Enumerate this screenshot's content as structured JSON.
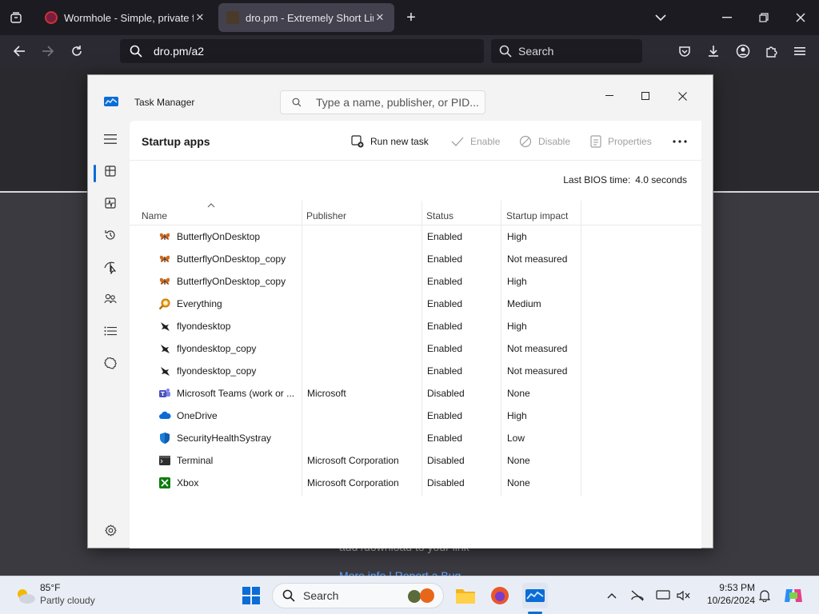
{
  "browser": {
    "tabs": [
      {
        "title": "Wormhole - Simple, private file",
        "active": false
      },
      {
        "title": "dro.pm - Extremely Short Links",
        "active": true
      }
    ],
    "url": "dro.pm/a2",
    "search_placeholder": "Search"
  },
  "background_page": {
    "text": "add /download to your link",
    "links": "More info | Report a Bug"
  },
  "task_manager": {
    "app_title": "Task Manager",
    "search_placeholder": "Type a name, publisher, or PID...",
    "section_title": "Startup apps",
    "toolbar": {
      "run_new_task": "Run new task",
      "enable": "Enable",
      "disable": "Disable",
      "properties": "Properties"
    },
    "bios_label": "Last BIOS time:",
    "bios_value": "4.0 seconds",
    "columns": {
      "name": "Name",
      "publisher": "Publisher",
      "status": "Status",
      "impact": "Startup impact"
    },
    "rows": [
      {
        "name": "ButterflyOnDesktop",
        "publisher": "",
        "status": "Enabled",
        "impact": "High",
        "icon": "butterfly-icon"
      },
      {
        "name": "ButterflyOnDesktop_copy",
        "publisher": "",
        "status": "Enabled",
        "impact": "Not measured",
        "icon": "butterfly-icon"
      },
      {
        "name": "ButterflyOnDesktop_copy",
        "publisher": "",
        "status": "Enabled",
        "impact": "High",
        "icon": "butterfly-icon"
      },
      {
        "name": "Everything",
        "publisher": "",
        "status": "Enabled",
        "impact": "Medium",
        "icon": "magnifier-icon"
      },
      {
        "name": "flyondesktop",
        "publisher": "",
        "status": "Enabled",
        "impact": "High",
        "icon": "bird-icon"
      },
      {
        "name": "flyondesktop_copy",
        "publisher": "",
        "status": "Enabled",
        "impact": "Not measured",
        "icon": "bird-icon"
      },
      {
        "name": "flyondesktop_copy",
        "publisher": "",
        "status": "Enabled",
        "impact": "Not measured",
        "icon": "bird-icon"
      },
      {
        "name": "Microsoft Teams (work or ...",
        "publisher": "Microsoft",
        "status": "Disabled",
        "impact": "None",
        "icon": "teams-icon"
      },
      {
        "name": "OneDrive",
        "publisher": "",
        "status": "Enabled",
        "impact": "High",
        "icon": "cloud-icon"
      },
      {
        "name": "SecurityHealthSystray",
        "publisher": "",
        "status": "Enabled",
        "impact": "Low",
        "icon": "shield-icon"
      },
      {
        "name": "Terminal",
        "publisher": "Microsoft Corporation",
        "status": "Disabled",
        "impact": "None",
        "icon": "terminal-icon"
      },
      {
        "name": "Xbox",
        "publisher": "Microsoft Corporation",
        "status": "Disabled",
        "impact": "None",
        "icon": "xbox-icon"
      }
    ]
  },
  "taskbar": {
    "weather_temp": "85°F",
    "weather_desc": "Partly cloudy",
    "search_label": "Search",
    "time": "9:53 PM",
    "date": "10/26/2024"
  },
  "colors": {
    "accent": "#0a6cd6",
    "browser_bg": "#1c1b22",
    "taskbar_bg": "#e9eef6"
  }
}
